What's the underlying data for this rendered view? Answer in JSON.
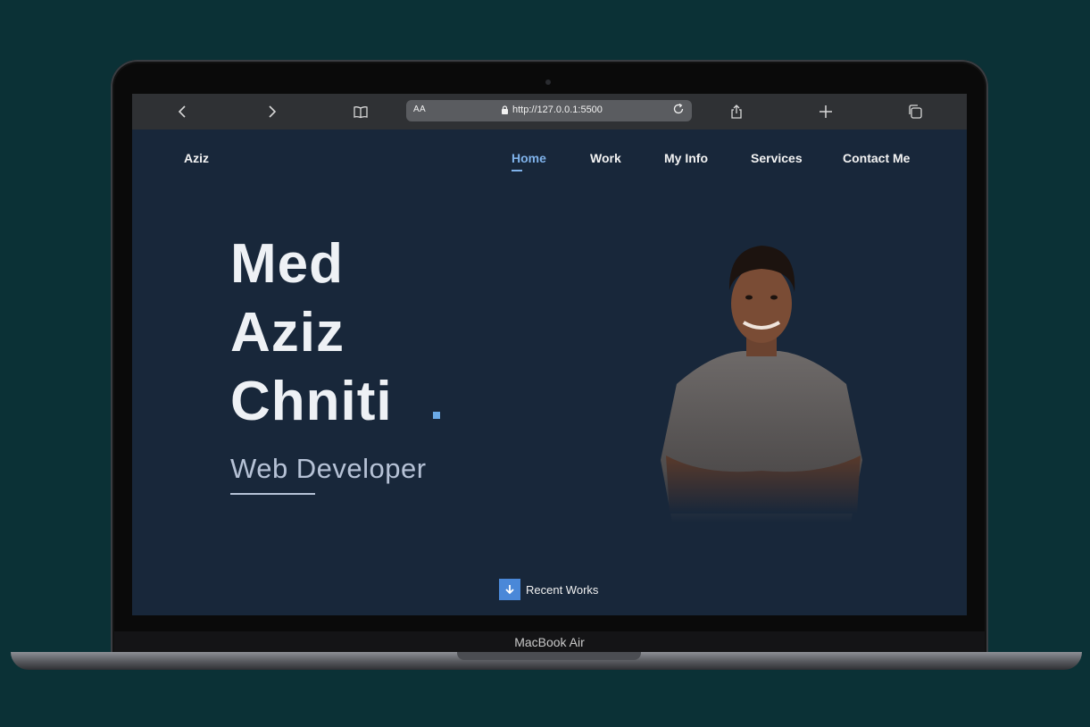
{
  "device": {
    "label": "MacBook Air"
  },
  "browser": {
    "text_size_label": "AA",
    "url": "http://127.0.0.1:5500",
    "icons": [
      "back-icon",
      "forward-icon",
      "bookmarks-icon",
      "lock-icon",
      "reload-icon",
      "share-icon",
      "new-tab-icon",
      "tabs-icon"
    ]
  },
  "site": {
    "logo": "Aziz",
    "nav": [
      {
        "label": "Home",
        "active": true
      },
      {
        "label": "Work",
        "active": false
      },
      {
        "label": "My Info",
        "active": false
      },
      {
        "label": "Services",
        "active": false
      },
      {
        "label": "Contact Me",
        "active": false
      }
    ],
    "hero": {
      "name_lines": [
        "Med",
        "Aziz",
        "Chniti"
      ],
      "role": "Web Developer"
    },
    "cta": {
      "label": "Recent Works",
      "icon": "arrow-down-icon"
    }
  },
  "colors": {
    "page_bg": "#0b3136",
    "screen_bg": "#18273a",
    "accent": "#7fb2ea",
    "cta_bg": "#4a88d8"
  }
}
